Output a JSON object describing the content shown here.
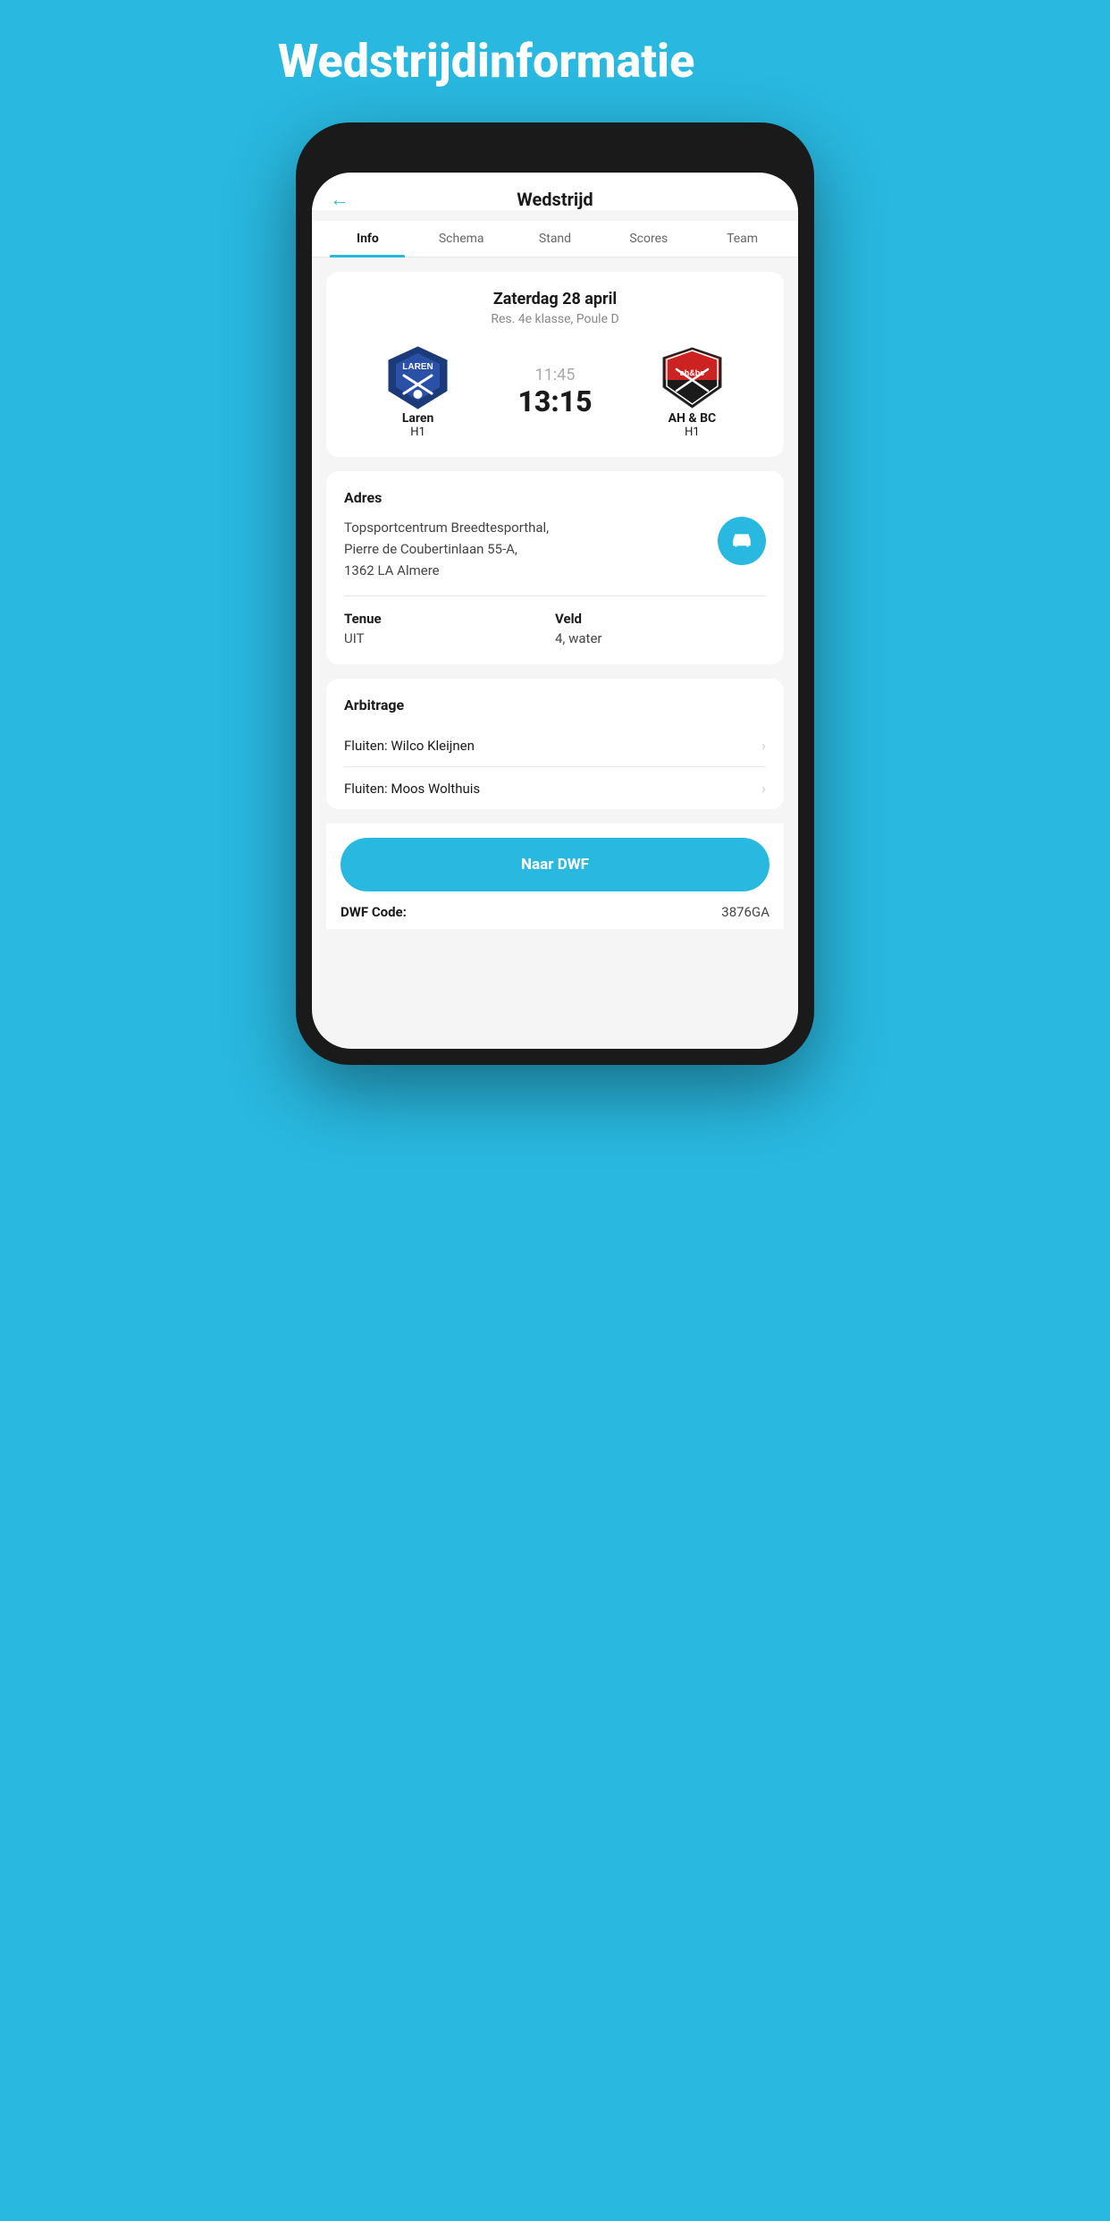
{
  "page": {
    "background_title": "Wedstrijdinformatie",
    "header": {
      "back_label": "←",
      "title": "Wedstrijd"
    },
    "tabs": [
      {
        "label": "Info",
        "active": true
      },
      {
        "label": "Schema",
        "active": false
      },
      {
        "label": "Stand",
        "active": false
      },
      {
        "label": "Scores",
        "active": false
      },
      {
        "label": "Team",
        "active": false
      }
    ],
    "match": {
      "date": "Zaterdag 28 april",
      "league": "Res. 4e klasse, Poule D",
      "home_team_name": "Laren",
      "home_team_sub": "H1",
      "away_team_name": "AH & BC",
      "away_team_sub": "H1",
      "score_time": "11:45",
      "score_main": "13:15"
    },
    "address": {
      "section_label": "Adres",
      "text_line1": "Topsportcentrum Breedtesporthal,",
      "text_line2": "Pierre de Coubertinlaan 55-A,",
      "text_line3": "1362 LA Almere"
    },
    "details": {
      "tenue_label": "Tenue",
      "tenue_value": "UIT",
      "veld_label": "Veld",
      "veld_value": "4, water"
    },
    "arbitrage": {
      "section_label": "Arbitrage",
      "items": [
        {
          "label": "Fluiten: Wilco Kleijnen"
        },
        {
          "label": "Fluiten: Moos Wolthuis"
        }
      ]
    },
    "dwf": {
      "button_label": "Naar DWF",
      "code_label": "DWF Code:",
      "code_value": "3876GA"
    }
  }
}
